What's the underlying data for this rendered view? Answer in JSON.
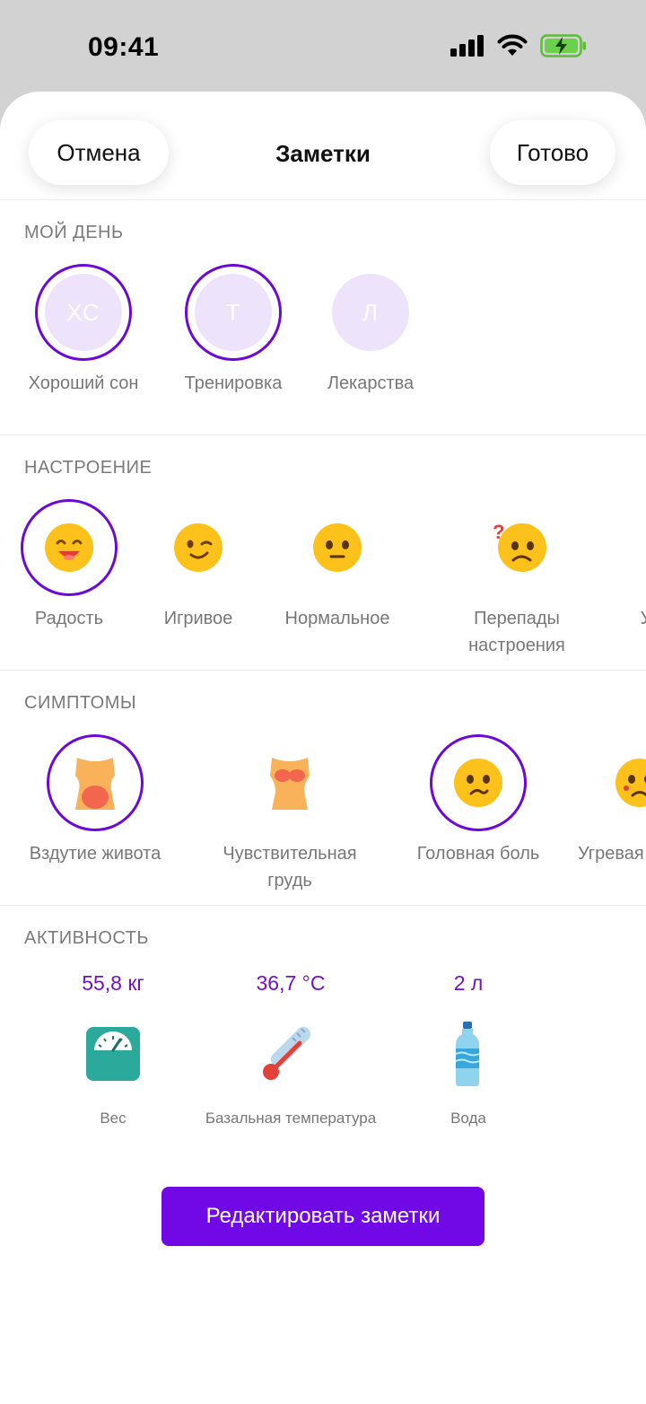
{
  "status_bar": {
    "time": "09:41"
  },
  "header": {
    "cancel_label": "Отмена",
    "title": "Заметки",
    "done_label": "Готово"
  },
  "my_day": {
    "title": "МОЙ ДЕНЬ",
    "items": [
      {
        "initials": "ХС",
        "label": "Хороший сон",
        "selected": true
      },
      {
        "initials": "Т",
        "label": "Тренировка",
        "selected": true
      },
      {
        "initials": "Л",
        "label": "Лекарства",
        "selected": false
      }
    ]
  },
  "mood": {
    "title": "НАСТРОЕНИЕ",
    "items": [
      {
        "icon": "happy-face-icon",
        "label": "Радость",
        "selected": true
      },
      {
        "icon": "winking-face-icon",
        "label": "Игривое",
        "selected": false
      },
      {
        "icon": "neutral-face-icon",
        "label": "Нормальное",
        "selected": false
      },
      {
        "icon": "confused-face-icon",
        "label": "Перепады\nнастроения",
        "selected": false
      },
      {
        "icon": "next-mood-icon",
        "label": "У",
        "selected": false
      }
    ]
  },
  "symptoms": {
    "title": "СИМПТОМЫ",
    "items": [
      {
        "icon": "bloated-belly-icon",
        "label": "Вздутие живота",
        "selected": true
      },
      {
        "icon": "tender-breast-icon",
        "label": "Чувствительная\nгрудь",
        "selected": false
      },
      {
        "icon": "headache-face-icon",
        "label": "Головная боль",
        "selected": true
      },
      {
        "icon": "acne-face-icon",
        "label": "Угревая",
        "selected": false
      }
    ]
  },
  "activity": {
    "title": "АКТИВНОСТЬ",
    "items": [
      {
        "value": "55,8 кг",
        "icon": "scale-icon",
        "label": "Вес"
      },
      {
        "value": "36,7 °C",
        "icon": "thermometer-icon",
        "label": "Базальная температура"
      },
      {
        "value": "2 л",
        "icon": "water-bottle-icon",
        "label": "Вода"
      }
    ]
  },
  "edit_button": {
    "label": "Редактировать заметки"
  },
  "colors": {
    "accent": "#7009e6",
    "ring": "#6b0ad6",
    "value_text": "#7411c8",
    "badge_bg": "#ede4fb"
  }
}
